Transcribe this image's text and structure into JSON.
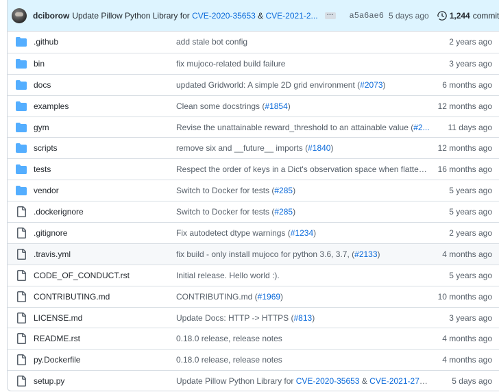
{
  "latest_commit": {
    "author": "dciborow",
    "message_prefix": "Update Pillow Python Library for ",
    "cve1": "CVE-2020-35653",
    "amp": " & ",
    "cve2": "CVE-2021-2...",
    "ellipsis": "…",
    "sha": "a5a6ae6",
    "date": "5 days ago",
    "commit_count": "1,244",
    "commits_label": "commits"
  },
  "files": [
    {
      "type": "folder",
      "name": ".github",
      "msg": "add stale bot config",
      "link": "",
      "msg_after": "",
      "age": "2 years ago"
    },
    {
      "type": "folder",
      "name": "bin",
      "msg": "fix mujoco-related build failure",
      "link": "",
      "msg_after": "",
      "age": "3 years ago"
    },
    {
      "type": "folder",
      "name": "docs",
      "msg": "updated Gridworld: A simple 2D grid environment (",
      "link": "#2073",
      "msg_after": ")",
      "age": "6 months ago"
    },
    {
      "type": "folder",
      "name": "examples",
      "msg": "Clean some docstrings (",
      "link": "#1854",
      "msg_after": ")",
      "age": "12 months ago"
    },
    {
      "type": "folder",
      "name": "gym",
      "msg": "Revise the unattainable reward_threshold to an attainable value (",
      "link": "#2...",
      "msg_after": "",
      "age": "11 days ago"
    },
    {
      "type": "folder",
      "name": "scripts",
      "msg": "remove six and __future__ imports (",
      "link": "#1840",
      "msg_after": ")",
      "age": "12 months ago"
    },
    {
      "type": "folder",
      "name": "tests",
      "msg": "Respect the order of keys in a Dict's observation space when flatteni...",
      "link": "",
      "msg_after": "",
      "age": "16 months ago"
    },
    {
      "type": "folder",
      "name": "vendor",
      "msg": "Switch to Docker for tests (",
      "link": "#285",
      "msg_after": ")",
      "age": "5 years ago"
    },
    {
      "type": "file",
      "name": ".dockerignore",
      "msg": "Switch to Docker for tests (",
      "link": "#285",
      "msg_after": ")",
      "age": "5 years ago"
    },
    {
      "type": "file",
      "name": ".gitignore",
      "msg": "Fix autodetect dtype warnings (",
      "link": "#1234",
      "msg_after": ")",
      "age": "2 years ago"
    },
    {
      "type": "file",
      "name": ".travis.yml",
      "msg": "fix build - only install mujoco for python 3.6, 3.7, (",
      "link": "#2133",
      "msg_after": ")",
      "age": "4 months ago"
    },
    {
      "type": "file",
      "name": "CODE_OF_CONDUCT.rst",
      "msg": "Initial release. Hello world :).",
      "link": "",
      "msg_after": "",
      "age": "5 years ago"
    },
    {
      "type": "file",
      "name": "CONTRIBUTING.md",
      "msg": "CONTRIBUTING.md (",
      "link": "#1969",
      "msg_after": ")",
      "age": "10 months ago"
    },
    {
      "type": "file",
      "name": "LICENSE.md",
      "msg": "Update Docs: HTTP -> HTTPS (",
      "link": "#813",
      "msg_after": ")",
      "age": "3 years ago"
    },
    {
      "type": "file",
      "name": "README.rst",
      "msg": "0.18.0 release, release notes",
      "link": "",
      "msg_after": "",
      "age": "4 months ago"
    },
    {
      "type": "file",
      "name": "py.Dockerfile",
      "msg": "0.18.0 release, release notes",
      "link": "",
      "msg_after": "",
      "age": "4 months ago"
    },
    {
      "type": "file",
      "name": "setup.py",
      "msg": "Update Pillow Python Library for ",
      "link": "CVE-2020-35653",
      "msg_after": " & ",
      "link2": "CVE-2021-279...",
      "age": "5 days ago"
    }
  ],
  "colors": {
    "folder": "#54aeff",
    "link": "#0969da",
    "header_bg": "#ddf4ff"
  },
  "icons": {
    "folder": "folder-icon",
    "file": "file-icon",
    "history": "history-clock-icon"
  }
}
